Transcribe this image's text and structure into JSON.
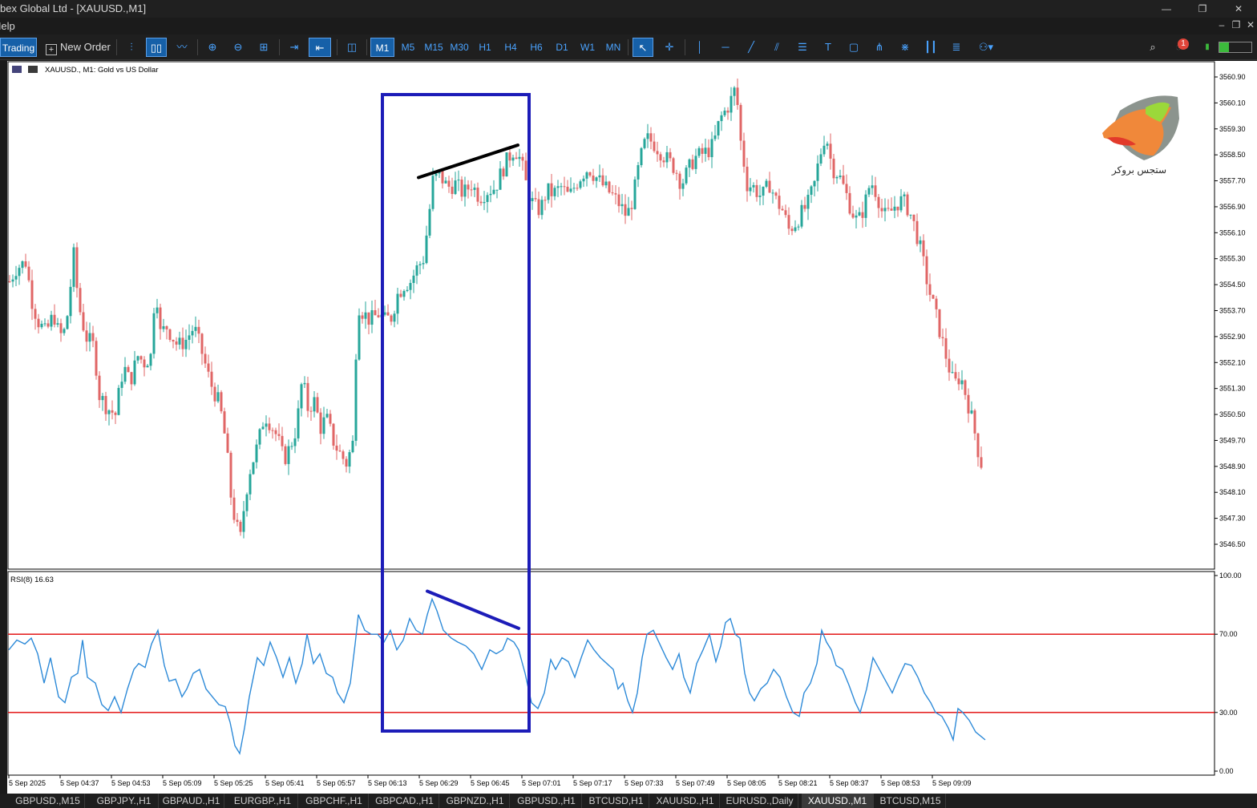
{
  "window": {
    "title": "bex Global Ltd - [XAUUSD.,M1]",
    "min": "—",
    "restore": "❐",
    "close": "✕"
  },
  "menu": {
    "help": "Help",
    "mdi_min": "–",
    "mdi_restore": "❐",
    "mdi_close": "✕"
  },
  "toolbar": {
    "trading": "Trading",
    "new_order": "New Order",
    "timeframes": [
      "M1",
      "M5",
      "M15",
      "M30",
      "H1",
      "H4",
      "H6",
      "D1",
      "W1",
      "MN"
    ],
    "active_timeframe": "M1",
    "notification_count": "1",
    "tools": [
      "line-chart-icon",
      "candles-icon",
      "area-icon",
      "zoom-in-icon",
      "zoom-out-icon",
      "grid-icon",
      "autoscroll-icon",
      "chart-shift-icon",
      "screenshot-icon",
      "cursor-icon",
      "crosshair-icon",
      "vertical-line-icon",
      "horizontal-line-icon",
      "trend-line-icon",
      "channel-icon",
      "fibo-icon",
      "text-icon",
      "rectangle-icon",
      "pitchfork-icon",
      "fan-icon",
      "cycle-icon",
      "gann-icon",
      "shapes-icon",
      "search-icon",
      "notifications-icon",
      "signal-icon"
    ]
  },
  "chart": {
    "symbol_label": "XAUUSD., M1:  Gold vs US Dollar",
    "logo_text": "ستجس بروکر",
    "price_axis": [
      "3560.90",
      "3560.10",
      "3559.30",
      "3558.50",
      "3557.70",
      "3556.90",
      "3556.10",
      "3555.30",
      "3554.50",
      "3553.70",
      "3552.90",
      "3552.10",
      "3551.30",
      "3550.50",
      "3549.70",
      "3548.90",
      "3548.10",
      "3547.30",
      "3546.50"
    ],
    "rsi_label": "RSI(8) 16.63",
    "rsi_axis": [
      "100.00",
      "70.00",
      "30.00",
      "0.00"
    ],
    "time_axis": [
      "5 Sep 2025",
      "5 Sep 04:37",
      "5 Sep 04:53",
      "5 Sep 05:09",
      "5 Sep 05:25",
      "5 Sep 05:41",
      "5 Sep 05:57",
      "5 Sep 06:13",
      "5 Sep 06:29",
      "5 Sep 06:45",
      "5 Sep 07:01",
      "5 Sep 07:17",
      "5 Sep 07:33",
      "5 Sep 07:49",
      "5 Sep 08:05",
      "5 Sep 08:21",
      "5 Sep 08:37",
      "5 Sep 08:53",
      "5 Sep 09:09"
    ],
    "colors": {
      "bull": "#26a69a",
      "bear": "#e06666",
      "rsi": "#2d8ad8",
      "levels": "#e00000",
      "box": "#1c1cb8"
    }
  },
  "chart_data": {
    "type": "candlestick",
    "symbol": "XAUUSD.",
    "timeframe": "M1",
    "ylim": [
      3545.9,
      3561.2
    ],
    "close_path": [
      [
        0,
        3554.6
      ],
      [
        8,
        3555.0
      ],
      [
        20,
        3555.2
      ],
      [
        28,
        3554.0
      ],
      [
        35,
        3553.4
      ],
      [
        45,
        3553.0
      ],
      [
        55,
        3553.6
      ],
      [
        62,
        3552.9
      ],
      [
        70,
        3553.1
      ],
      [
        80,
        3555.4
      ],
      [
        86,
        3553.9
      ],
      [
        95,
        3552.9
      ],
      [
        105,
        3552.6
      ],
      [
        112,
        3551.1
      ],
      [
        122,
        3550.7
      ],
      [
        132,
        3550.5
      ],
      [
        142,
        3552.0
      ],
      [
        150,
        3551.5
      ],
      [
        160,
        3552.3
      ],
      [
        168,
        3552.1
      ],
      [
        176,
        3552.3
      ],
      [
        182,
        3554.6
      ],
      [
        188,
        3553.0
      ],
      [
        196,
        3553.2
      ],
      [
        203,
        3552.9
      ],
      [
        210,
        3552.6
      ],
      [
        220,
        3552.8
      ],
      [
        230,
        3553.2
      ],
      [
        240,
        3552.4
      ],
      [
        250,
        3551.5
      ],
      [
        262,
        3550.8
      ],
      [
        270,
        3549.6
      ],
      [
        276,
        3548.0
      ],
      [
        282,
        3547.1
      ],
      [
        288,
        3546.7
      ],
      [
        294,
        3548.0
      ],
      [
        300,
        3548.8
      ],
      [
        310,
        3549.6
      ],
      [
        318,
        3550.5
      ],
      [
        326,
        3550.2
      ],
      [
        334,
        3549.8
      ],
      [
        342,
        3549.1
      ],
      [
        350,
        3549.5
      ],
      [
        358,
        3550.1
      ],
      [
        365,
        3551.6
      ],
      [
        372,
        3550.7
      ],
      [
        380,
        3550.9
      ],
      [
        388,
        3550.1
      ],
      [
        395,
        3550.4
      ],
      [
        405,
        3549.6
      ],
      [
        412,
        3549.3
      ],
      [
        420,
        3549.0
      ],
      [
        428,
        3549.6
      ],
      [
        434,
        3553.9
      ],
      [
        442,
        3553.6
      ],
      [
        450,
        3553.4
      ],
      [
        460,
        3553.6
      ],
      [
        468,
        3553.4
      ],
      [
        476,
        3553.5
      ],
      [
        484,
        3554.2
      ],
      [
        492,
        3554.5
      ],
      [
        500,
        3554.6
      ],
      [
        508,
        3555.0
      ],
      [
        516,
        3555.3
      ],
      [
        522,
        3556.4
      ],
      [
        528,
        3557.7
      ],
      [
        536,
        3557.9
      ],
      [
        546,
        3557.5
      ],
      [
        556,
        3557.6
      ],
      [
        566,
        3557.3
      ],
      [
        576,
        3557.6
      ],
      [
        586,
        3557.2
      ],
      [
        596,
        3557.4
      ],
      [
        606,
        3557.5
      ],
      [
        614,
        3558.0
      ],
      [
        622,
        3558.4
      ],
      [
        630,
        3558.7
      ],
      [
        638,
        3558.3
      ],
      [
        646,
        3557.4
      ],
      [
        654,
        3556.9
      ],
      [
        662,
        3556.8
      ],
      [
        670,
        3557.4
      ],
      [
        678,
        3557.3
      ],
      [
        688,
        3557.5
      ],
      [
        698,
        3557.2
      ],
      [
        706,
        3557.6
      ],
      [
        714,
        3557.9
      ],
      [
        722,
        3558.1
      ],
      [
        732,
        3557.8
      ],
      [
        742,
        3557.5
      ],
      [
        750,
        3557.3
      ],
      [
        760,
        3557.0
      ],
      [
        770,
        3556.6
      ],
      [
        778,
        3557.2
      ],
      [
        786,
        3558.3
      ],
      [
        794,
        3559.0
      ],
      [
        802,
        3558.9
      ],
      [
        812,
        3558.6
      ],
      [
        822,
        3558.3
      ],
      [
        830,
        3558.1
      ],
      [
        838,
        3557.6
      ],
      [
        846,
        3558.0
      ],
      [
        854,
        3558.4
      ],
      [
        862,
        3558.5
      ],
      [
        870,
        3558.6
      ],
      [
        878,
        3558.8
      ],
      [
        886,
        3559.6
      ],
      [
        894,
        3559.9
      ],
      [
        900,
        3560.2
      ],
      [
        906,
        3560.6
      ],
      [
        912,
        3558.9
      ],
      [
        920,
        3557.6
      ],
      [
        928,
        3557.5
      ],
      [
        938,
        3557.2
      ],
      [
        948,
        3557.6
      ],
      [
        956,
        3557.1
      ],
      [
        964,
        3556.8
      ],
      [
        972,
        3556.2
      ],
      [
        980,
        3556.4
      ],
      [
        988,
        3556.7
      ],
      [
        996,
        3557.0
      ],
      [
        1004,
        3557.6
      ],
      [
        1010,
        3558.4
      ],
      [
        1018,
        3559.2
      ],
      [
        1026,
        3558.1
      ],
      [
        1034,
        3557.9
      ],
      [
        1042,
        3557.4
      ],
      [
        1050,
        3556.8
      ],
      [
        1058,
        3556.4
      ],
      [
        1066,
        3556.9
      ],
      [
        1074,
        3557.7
      ],
      [
        1082,
        3557.3
      ],
      [
        1090,
        3556.6
      ],
      [
        1098,
        3556.7
      ],
      [
        1106,
        3557.0
      ],
      [
        1114,
        3557.1
      ],
      [
        1122,
        3556.8
      ],
      [
        1130,
        3556.2
      ],
      [
        1138,
        3555.4
      ],
      [
        1146,
        3554.4
      ],
      [
        1154,
        3553.7
      ],
      [
        1162,
        3552.9
      ],
      [
        1170,
        3552.1
      ],
      [
        1178,
        3551.4
      ],
      [
        1186,
        3551.7
      ],
      [
        1194,
        3551.0
      ],
      [
        1202,
        3550.2
      ],
      [
        1208,
        3549.4
      ],
      [
        1214,
        3548.8
      ]
    ],
    "rsi": {
      "period": 8,
      "last": 16.63,
      "levels": [
        70,
        30
      ],
      "path": [
        [
          0,
          62
        ],
        [
          10,
          67
        ],
        [
          20,
          65
        ],
        [
          28,
          68
        ],
        [
          36,
          60
        ],
        [
          44,
          45
        ],
        [
          52,
          58
        ],
        [
          62,
          38
        ],
        [
          70,
          35
        ],
        [
          78,
          48
        ],
        [
          86,
          50
        ],
        [
          92,
          67
        ],
        [
          98,
          48
        ],
        [
          108,
          45
        ],
        [
          116,
          34
        ],
        [
          124,
          31
        ],
        [
          132,
          38
        ],
        [
          140,
          30
        ],
        [
          148,
          42
        ],
        [
          156,
          52
        ],
        [
          162,
          55
        ],
        [
          170,
          53
        ],
        [
          178,
          65
        ],
        [
          186,
          72
        ],
        [
          194,
          54
        ],
        [
          200,
          46
        ],
        [
          208,
          47
        ],
        [
          216,
          38
        ],
        [
          222,
          42
        ],
        [
          230,
          50
        ],
        [
          238,
          52
        ],
        [
          246,
          42
        ],
        [
          254,
          38
        ],
        [
          262,
          34
        ],
        [
          270,
          33
        ],
        [
          276,
          25
        ],
        [
          282,
          13
        ],
        [
          288,
          9
        ],
        [
          294,
          22
        ],
        [
          300,
          38
        ],
        [
          310,
          58
        ],
        [
          318,
          54
        ],
        [
          326,
          66
        ],
        [
          334,
          58
        ],
        [
          342,
          48
        ],
        [
          350,
          58
        ],
        [
          358,
          45
        ],
        [
          366,
          55
        ],
        [
          372,
          70
        ],
        [
          380,
          55
        ],
        [
          388,
          60
        ],
        [
          396,
          50
        ],
        [
          404,
          48
        ],
        [
          410,
          40
        ],
        [
          418,
          35
        ],
        [
          426,
          45
        ],
        [
          432,
          65
        ],
        [
          436,
          80
        ],
        [
          444,
          72
        ],
        [
          452,
          70
        ],
        [
          460,
          70
        ],
        [
          468,
          66
        ],
        [
          476,
          72
        ],
        [
          484,
          62
        ],
        [
          492,
          67
        ],
        [
          500,
          78
        ],
        [
          508,
          72
        ],
        [
          516,
          70
        ],
        [
          522,
          80
        ],
        [
          528,
          88
        ],
        [
          534,
          82
        ],
        [
          542,
          72
        ],
        [
          552,
          68
        ],
        [
          560,
          66
        ],
        [
          570,
          64
        ],
        [
          580,
          60
        ],
        [
          590,
          52
        ],
        [
          600,
          62
        ],
        [
          608,
          60
        ],
        [
          616,
          62
        ],
        [
          622,
          68
        ],
        [
          630,
          66
        ],
        [
          636,
          62
        ],
        [
          644,
          50
        ],
        [
          652,
          35
        ],
        [
          660,
          32
        ],
        [
          668,
          40
        ],
        [
          676,
          57
        ],
        [
          682,
          52
        ],
        [
          690,
          58
        ],
        [
          698,
          56
        ],
        [
          706,
          48
        ],
        [
          714,
          58
        ],
        [
          722,
          67
        ],
        [
          730,
          62
        ],
        [
          738,
          58
        ],
        [
          746,
          55
        ],
        [
          754,
          52
        ],
        [
          760,
          42
        ],
        [
          766,
          45
        ],
        [
          772,
          36
        ],
        [
          778,
          30
        ],
        [
          784,
          40
        ],
        [
          790,
          58
        ],
        [
          796,
          70
        ],
        [
          804,
          72
        ],
        [
          812,
          65
        ],
        [
          820,
          58
        ],
        [
          828,
          52
        ],
        [
          836,
          60
        ],
        [
          842,
          48
        ],
        [
          850,
          40
        ],
        [
          858,
          55
        ],
        [
          866,
          62
        ],
        [
          874,
          70
        ],
        [
          882,
          56
        ],
        [
          888,
          64
        ],
        [
          894,
          76
        ],
        [
          900,
          78
        ],
        [
          906,
          70
        ],
        [
          912,
          68
        ],
        [
          918,
          50
        ],
        [
          924,
          40
        ],
        [
          930,
          36
        ],
        [
          938,
          42
        ],
        [
          946,
          45
        ],
        [
          954,
          52
        ],
        [
          962,
          48
        ],
        [
          970,
          38
        ],
        [
          978,
          30
        ],
        [
          986,
          28
        ],
        [
          992,
          40
        ],
        [
          1000,
          45
        ],
        [
          1008,
          55
        ],
        [
          1014,
          72
        ],
        [
          1020,
          66
        ],
        [
          1026,
          62
        ],
        [
          1032,
          54
        ],
        [
          1040,
          52
        ],
        [
          1048,
          44
        ],
        [
          1056,
          35
        ],
        [
          1062,
          30
        ],
        [
          1070,
          42
        ],
        [
          1078,
          58
        ],
        [
          1086,
          52
        ],
        [
          1094,
          46
        ],
        [
          1102,
          40
        ],
        [
          1110,
          48
        ],
        [
          1118,
          55
        ],
        [
          1126,
          54
        ],
        [
          1134,
          48
        ],
        [
          1142,
          40
        ],
        [
          1150,
          35
        ],
        [
          1156,
          30
        ],
        [
          1164,
          28
        ],
        [
          1172,
          22
        ],
        [
          1178,
          16
        ],
        [
          1184,
          32
        ],
        [
          1190,
          30
        ],
        [
          1198,
          26
        ],
        [
          1206,
          20
        ],
        [
          1212,
          18
        ],
        [
          1218,
          16
        ]
      ]
    },
    "annotations": [
      {
        "type": "rectangle",
        "from_time": "5 Sep 06:13",
        "to_time": "5 Sep 07:01"
      },
      {
        "type": "trendline",
        "pane": "price",
        "from": [
          511,
          3557.8
        ],
        "to": [
          635,
          3558.8
        ]
      },
      {
        "type": "trendline",
        "pane": "rsi",
        "from": [
          522,
          92
        ],
        "to": [
          636,
          73
        ]
      }
    ],
    "xlabel": "",
    "ylabel": ""
  },
  "tabs": [
    "GBPUSD.,M15",
    "GBPJPY.,H1",
    "GBPAUD.,H1",
    "EURGBP.,H1",
    "GBPCHF.,H1",
    "GBPCAD.,H1",
    "GBPNZD.,H1",
    "GBPUSD.,H1",
    "BTCUSD,H1",
    "XAUUSD.,H1",
    "EURUSD.,Daily",
    "XAUUSD.,M1",
    "BTCUSD,M15"
  ],
  "active_tab": "XAUUSD.,M1"
}
